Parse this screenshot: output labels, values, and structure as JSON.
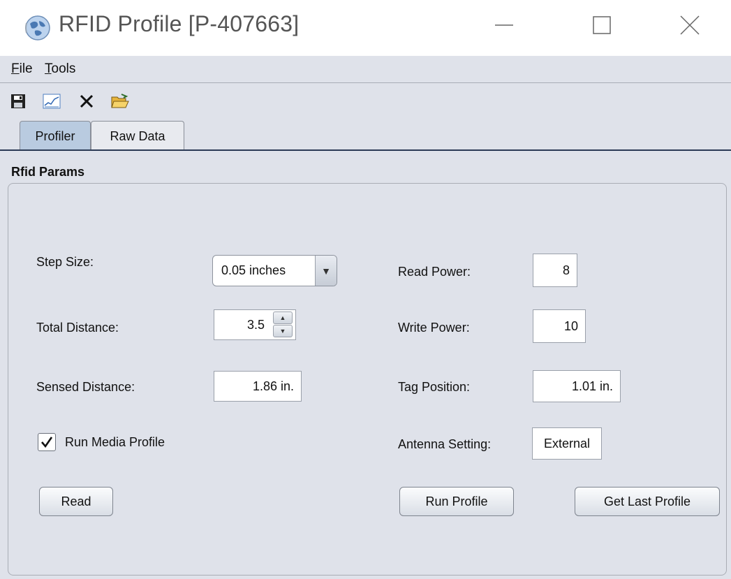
{
  "window": {
    "title": "RFID Profile  [P-407663]",
    "icon": "rfid-globe-icon"
  },
  "menu": {
    "file_mnemonic": "F",
    "file_rest": "ile",
    "tools_mnemonic": "T",
    "tools_rest": "ools"
  },
  "toolbar": {
    "icons": [
      "save-icon",
      "chart-icon",
      "delete-icon",
      "open-folder-icon"
    ]
  },
  "tabs": [
    {
      "label": "Profiler",
      "selected": true
    },
    {
      "label": "Raw Data",
      "selected": false
    }
  ],
  "panel": {
    "title": "Rfid Params",
    "step_size": {
      "label": "Step Size:",
      "value": "0.05 inches"
    },
    "total_distance": {
      "label": "Total Distance:",
      "value": "3.5"
    },
    "sensed_distance": {
      "label": "Sensed Distance:",
      "value": "1.86 in."
    },
    "run_media_profile": {
      "label": "Run Media Profile",
      "checked": true
    },
    "read_button": "Read",
    "read_power": {
      "label": "Read Power:",
      "value": "8"
    },
    "write_power": {
      "label": "Write Power:",
      "value": "10"
    },
    "tag_position": {
      "label": "Tag Position:",
      "value": "1.01 in."
    },
    "antenna_setting": {
      "label": "Antenna Setting:",
      "value": "External"
    },
    "run_profile_button": "Run Profile",
    "get_last_profile_button": "Get Last Profile"
  },
  "colors": {
    "panel_bg": "#dfe2ea",
    "tab_selected": "#b9cbe0",
    "title_text": "#555555"
  }
}
